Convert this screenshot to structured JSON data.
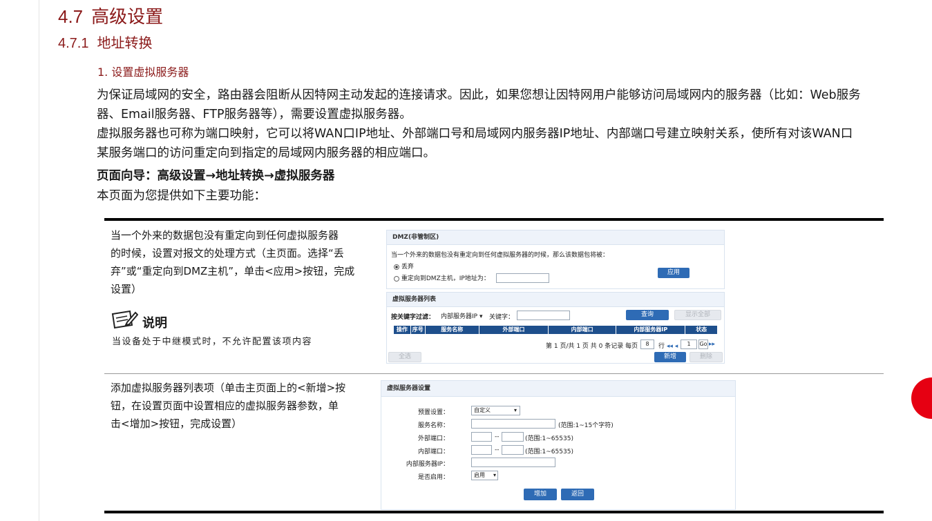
{
  "heading": {
    "num": "4.7",
    "title": "高级设置"
  },
  "subheading": {
    "num": "4.7.1",
    "title": "地址转换"
  },
  "section": "1. 设置虚拟服务器",
  "paragraphs": {
    "p1_line1": "为保证局域网的安全，路由器会阻断从因特网主动发起的连接请求。因此，如果您想让因特网用户能够访问局域网内的服务器（比如：Web服务",
    "p1_line2": "器、Email服务器、FTP服务器等），需要设置虚拟服务器。",
    "p2_line1": "虚拟服务器也可称为端口映射，它可以将WAN口IP地址、外部端口号和局域网内服务器IP地址、内部端口号建立映射关系，使所有对该WAN口",
    "p2_line2": "某服务端口的访问重定向到指定的局域网内服务器的相应端口。",
    "nav": "页面向导：高级设置→地址转换→虚拟服务器",
    "intro": "本页面为您提供如下主要功能："
  },
  "table": {
    "row1": {
      "desc_lines": [
        "当一个外来的数据包没有重定向到任何虚拟服务器",
        "的时候，设置对报文的处理方式（主页面。选择“丢",
        "弃”或“重定向到DMZ主机”，单击<应用>按钮，完成",
        "设置）"
      ],
      "note_label": "说明",
      "note_text": "当设备处于中继模式时，不允许配置该项内容"
    },
    "row2": {
      "desc_lines": [
        "添加虚拟服务器列表项（单击主页面上的<新增>按",
        "钮，在设置页面中设置相应的虚拟服务器参数，单",
        "击<增加>按钮，完成设置）"
      ]
    }
  },
  "shot1": {
    "dmz_title": "DMZ(非管制区)",
    "dmz_prompt": "当一个外来的数据包没有重定向到任何虚拟服务器的时候，那么该数据包将被：",
    "opt_drop": "丢弃",
    "opt_dmz": "重定向到DMZ主机，IP地址为：",
    "apply": "应用",
    "list_title": "虚拟服务器列表",
    "filter_label": "按关键字过滤：",
    "filter_value": "内部服务器IP",
    "keyword_label": "关键字：",
    "query": "查询",
    "show_all": "显示全部",
    "columns": [
      "操作",
      "序号",
      "服务名称",
      "外部端口",
      "内部端口",
      "内部服务器IP",
      "状态"
    ],
    "pager": "第 1 页/共 1 页 共 0 条记录 每页",
    "per_page": "8",
    "row_word": "行",
    "page_num": "1",
    "go": "Go",
    "select_all": "全选",
    "add_new": "新增",
    "delete": "删除"
  },
  "shot2": {
    "title": "虚拟服务器设置",
    "preset_label": "预置设置：",
    "preset_value": "自定义",
    "service_label": "服务名称：",
    "service_hint": "(范围:1~15个字符)",
    "ext_label": "外部端口：",
    "ext_hint": "(范围:1~65535)",
    "int_label": "内部端口：",
    "int_hint": "(范围:1~65535)",
    "ip_label": "内部服务器IP：",
    "enable_label": "是否启用：",
    "enable_value": "启用",
    "dash": "--",
    "add": "增加",
    "back": "返回"
  },
  "colors": {
    "heading": "#8b1a1a",
    "button": "#2e6bb5",
    "table_header": "#1e4f8c",
    "side_marker": "#e60012"
  }
}
